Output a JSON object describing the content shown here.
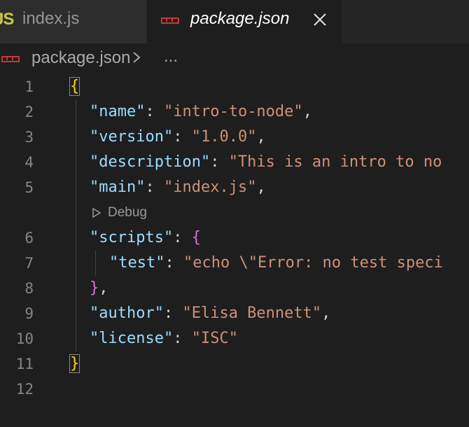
{
  "tabs": [
    {
      "icon": "js-icon",
      "icon_text": "JS",
      "label": "index.js",
      "active": false
    },
    {
      "icon": "npm-icon",
      "label": "package.json",
      "active": true
    }
  ],
  "breadcrumb": {
    "file": "package.json",
    "more": "..."
  },
  "editor": {
    "line_numbers": [
      "1",
      "2",
      "3",
      "4",
      "5",
      "6",
      "7",
      "8",
      "9",
      "10",
      "11",
      "12"
    ],
    "codelens": "Debug",
    "lines": {
      "l1": {
        "open": "{"
      },
      "l2": {
        "key": "\"name\"",
        "colon": ": ",
        "value": "\"intro-to-node\"",
        "comma": ","
      },
      "l3": {
        "key": "\"version\"",
        "colon": ": ",
        "value": "\"1.0.0\"",
        "comma": ","
      },
      "l4": {
        "key": "\"description\"",
        "colon": ": ",
        "value": "\"This is an intro to no"
      },
      "l5": {
        "key": "\"main\"",
        "colon": ": ",
        "value": "\"index.js\"",
        "comma": ","
      },
      "l6": {
        "key": "\"scripts\"",
        "colon": ": ",
        "open": "{"
      },
      "l7": {
        "key": "\"test\"",
        "colon": ": ",
        "value": "\"echo \\\"Error: no test speci"
      },
      "l8": {
        "close": "}",
        "comma": ","
      },
      "l9": {
        "key": "\"author\"",
        "colon": ": ",
        "value": "\"Elisa Bennett\"",
        "comma": ","
      },
      "l10": {
        "key": "\"license\"",
        "colon": ": ",
        "value": "\"ISC\""
      },
      "l11": {
        "close": "}"
      }
    }
  },
  "colors": {
    "background": "#1e1e1e",
    "key": "#9cdcfe",
    "string": "#ce9178",
    "bracket_level1": "#ffd700",
    "bracket_level2": "#da70d6",
    "npm_icon": "#cb3837",
    "js_icon": "#cbcb41"
  }
}
